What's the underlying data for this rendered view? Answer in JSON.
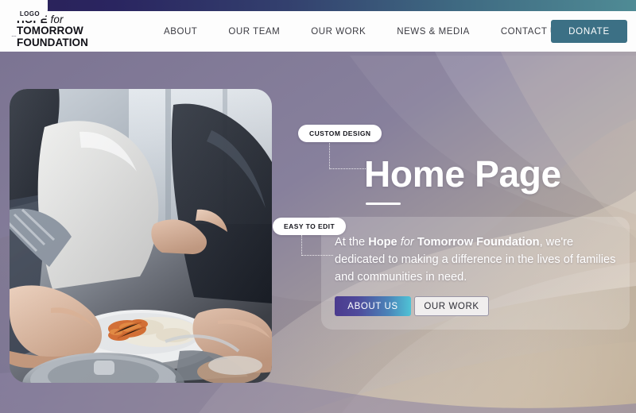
{
  "brand": {
    "logo_tab_label": "LOGO",
    "name_line1_part1": "HOPE",
    "name_line1_for": "for",
    "name_line1_part2": "TOMORROW",
    "name_line2": "FOUNDATION"
  },
  "nav": {
    "items": [
      {
        "label": "ABOUT"
      },
      {
        "label": "OUR TEAM"
      },
      {
        "label": "OUR WORK"
      },
      {
        "label": "NEWS & MEDIA"
      },
      {
        "label": "CONTACT US"
      }
    ],
    "donate_label": "DONATE",
    "donate_color": "#3c7085"
  },
  "hero": {
    "title": "Home Page",
    "badge_custom": "CUSTOM DESIGN",
    "badge_easy": "EASY TO EDIT",
    "paragraph": {
      "lead": "At the ",
      "brand_bold_1": "Hope",
      "brand_italic": " for ",
      "brand_bold_2": "Tomorrow Foundation",
      "rest": ", we're dedicated to making a difference in the lives of families and communities in need."
    },
    "cta_primary": "ABOUT US",
    "cta_secondary": "OUR WORK",
    "photo_alt": "hands-passing-plate-of-food-photo"
  },
  "theme": {
    "background": "#7d7694",
    "topbar_left": "#2b2158",
    "topbar_right": "#4f8b95",
    "cta_gradient_start": "#4b3b8e",
    "cta_gradient_end": "#4fc3d6"
  }
}
